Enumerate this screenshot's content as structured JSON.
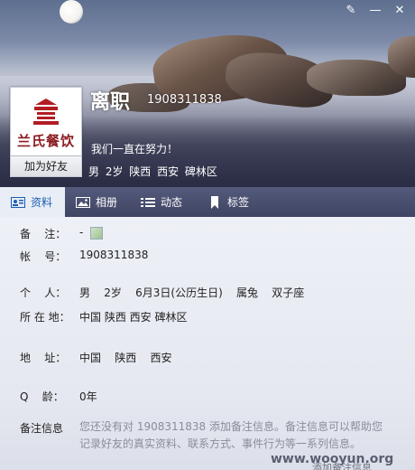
{
  "window": {
    "buttons": {
      "skin": "✎",
      "minimize": "—",
      "close": "✕"
    }
  },
  "profile": {
    "avatar_brand": "兰氏餐饮",
    "add_friend": "加为好友",
    "nickname": "离职",
    "qq_number": "1908311838",
    "signature": "我们一直在努力！",
    "brief": "男  2岁  陕西 西安 碑林区"
  },
  "tabs": [
    {
      "label": "资料",
      "icon": "profile-card-icon"
    },
    {
      "label": "相册",
      "icon": "photo-icon"
    },
    {
      "label": "动态",
      "icon": "feed-list-icon"
    },
    {
      "label": "标签",
      "icon": "bookmark-icon"
    }
  ],
  "details": {
    "note_label": "备    注：",
    "note_value": "-",
    "account_label": "帐    号：",
    "account_value": "1908311838",
    "personal_label": "个    人：",
    "personal_value": "男    2岁    6月3日(公历生日)    属兔    双子座",
    "location_label": "所 在 地：",
    "location_value": "中国 陕西 西安 碑林区",
    "address_label": "地    址：",
    "address_value": "中国    陕西    西安",
    "age_label": "Q    龄：",
    "age_value": "0年",
    "memo_label": "备注信息",
    "memo_value": "您还没有对 1908311838 添加备注信息。备注信息可以帮助您记录好友的真实资料、联系方式、事件行为等一系列信息。"
  },
  "footer": {
    "add_memo": "添加备注信息",
    "watermark": "www.wooyun.org"
  },
  "colors": {
    "tab_bar": "#4a4f70",
    "tab_active_text": "#1c5fb0",
    "brand_red": "#8b1a1f"
  }
}
